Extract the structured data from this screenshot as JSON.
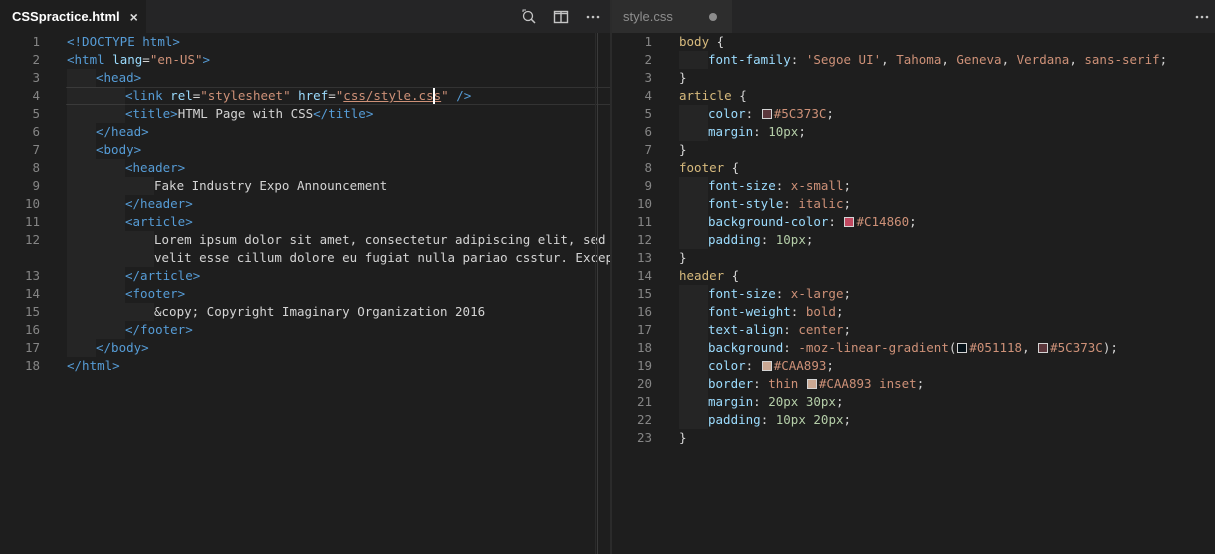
{
  "left_editor": {
    "tab": {
      "label": "CSSpractice.html",
      "close": "×"
    },
    "action_icons": [
      "open-changes-icon",
      "split-editor-icon",
      "more-actions-icon"
    ],
    "lines": [
      {
        "n": "1",
        "tokens": [
          [
            "tg",
            "<!DOCTYPE"
          ],
          [
            "br",
            " "
          ],
          [
            "tg",
            "html"
          ],
          [
            "tg",
            ">"
          ]
        ]
      },
      {
        "n": "2",
        "tokens": [
          [
            "tg",
            "<html"
          ],
          [
            "br",
            " "
          ],
          [
            "an",
            "lang"
          ],
          [
            "br",
            "="
          ],
          [
            "av",
            "\"en-US\""
          ],
          [
            "tg",
            ">"
          ]
        ]
      },
      {
        "n": "3",
        "indent": 1,
        "tokens": [
          [
            "tg",
            "<head>"
          ]
        ]
      },
      {
        "n": "4",
        "indent": 2,
        "tokens": [
          [
            "tg",
            "<link"
          ],
          [
            "br",
            " "
          ],
          [
            "an",
            "rel"
          ],
          [
            "br",
            "="
          ],
          [
            "av",
            "\"stylesheet\""
          ],
          [
            "br",
            " "
          ],
          [
            "an",
            "href"
          ],
          [
            "br",
            "="
          ],
          [
            "av",
            "\""
          ],
          [
            "avu",
            "css/style.css"
          ],
          [
            "av",
            "\""
          ],
          [
            "br",
            " "
          ],
          [
            "tg",
            "/>"
          ]
        ]
      },
      {
        "n": "5",
        "indent": 2,
        "tokens": [
          [
            "tg",
            "<title>"
          ],
          [
            "br",
            "HTML Page with CSS"
          ],
          [
            "tg",
            "</title>"
          ]
        ]
      },
      {
        "n": "6",
        "indent": 1,
        "tokens": [
          [
            "tg",
            "</head>"
          ]
        ]
      },
      {
        "n": "7",
        "indent": 1,
        "tokens": [
          [
            "tg",
            "<body>"
          ]
        ]
      },
      {
        "n": "8",
        "indent": 2,
        "tokens": [
          [
            "tg",
            "<header>"
          ]
        ]
      },
      {
        "n": "9",
        "indent": 3,
        "tokens": [
          [
            "br",
            "Fake Industry Expo Announcement"
          ]
        ]
      },
      {
        "n": "10",
        "indent": 2,
        "tokens": [
          [
            "tg",
            "</header>"
          ]
        ]
      },
      {
        "n": "11",
        "indent": 2,
        "tokens": [
          [
            "tg",
            "<article>"
          ]
        ]
      },
      {
        "n": "12",
        "indent": 3,
        "tokens": [
          [
            "br",
            "Lorem ipsum dolor sit amet, consectetur adipiscing elit, sed do"
          ]
        ]
      },
      {
        "n": "",
        "indent": 3,
        "tokens": [
          [
            "br",
            "velit esse cillum dolore eu fugiat nulla pariao csstur. Excepter"
          ]
        ]
      },
      {
        "n": "13",
        "indent": 2,
        "tokens": [
          [
            "tg",
            "</article>"
          ]
        ]
      },
      {
        "n": "14",
        "indent": 2,
        "tokens": [
          [
            "tg",
            "<footer>"
          ]
        ]
      },
      {
        "n": "15",
        "indent": 3,
        "tokens": [
          [
            "br",
            "&copy; Copyright Imaginary Organization 2016"
          ]
        ]
      },
      {
        "n": "16",
        "indent": 2,
        "tokens": [
          [
            "tg",
            "</footer>"
          ]
        ]
      },
      {
        "n": "17",
        "indent": 1,
        "tokens": [
          [
            "tg",
            "</body>"
          ]
        ]
      },
      {
        "n": "18",
        "tokens": [
          [
            "tg",
            "</html>"
          ]
        ]
      }
    ]
  },
  "right_editor": {
    "tab": {
      "label": "style.css",
      "dirty": true
    },
    "action_icons": [
      "more-actions-icon"
    ],
    "lines": [
      {
        "n": "1",
        "tokens": [
          [
            "sel",
            "body"
          ],
          [
            "br",
            " {"
          ]
        ]
      },
      {
        "n": "2",
        "indent": 1,
        "tokens": [
          [
            "pr",
            "font-family"
          ],
          [
            "br",
            ": "
          ],
          [
            "vl",
            "'Segoe UI'"
          ],
          [
            "br",
            ", "
          ],
          [
            "vl",
            "Tahoma"
          ],
          [
            "br",
            ", "
          ],
          [
            "vl",
            "Geneva"
          ],
          [
            "br",
            ", "
          ],
          [
            "vl",
            "Verdana"
          ],
          [
            "br",
            ", "
          ],
          [
            "vl",
            "sans-serif"
          ],
          [
            "br",
            ";"
          ]
        ]
      },
      {
        "n": "3",
        "tokens": [
          [
            "br",
            "}"
          ]
        ]
      },
      {
        "n": "4",
        "tokens": [
          [
            "sel",
            "article"
          ],
          [
            "br",
            " {"
          ]
        ]
      },
      {
        "n": "5",
        "indent": 1,
        "tokens": [
          [
            "pr",
            "color"
          ],
          [
            "br",
            ": "
          ],
          [
            "sw",
            "#5C373C"
          ],
          [
            "vl",
            "#5C373C"
          ],
          [
            "br",
            ";"
          ]
        ]
      },
      {
        "n": "6",
        "indent": 1,
        "tokens": [
          [
            "pr",
            "margin"
          ],
          [
            "br",
            ": "
          ],
          [
            "nm",
            "10px"
          ],
          [
            "br",
            ";"
          ]
        ]
      },
      {
        "n": "7",
        "tokens": [
          [
            "br",
            "}"
          ]
        ]
      },
      {
        "n": "8",
        "tokens": [
          [
            "sel",
            "footer"
          ],
          [
            "br",
            " {"
          ]
        ]
      },
      {
        "n": "9",
        "indent": 1,
        "tokens": [
          [
            "pr",
            "font-size"
          ],
          [
            "br",
            ": "
          ],
          [
            "vl",
            "x-small"
          ],
          [
            "br",
            ";"
          ]
        ]
      },
      {
        "n": "10",
        "indent": 1,
        "tokens": [
          [
            "pr",
            "font-style"
          ],
          [
            "br",
            ": "
          ],
          [
            "vl",
            "italic"
          ],
          [
            "br",
            ";"
          ]
        ]
      },
      {
        "n": "11",
        "indent": 1,
        "tokens": [
          [
            "pr",
            "background-color"
          ],
          [
            "br",
            ": "
          ],
          [
            "sw",
            "#C14860"
          ],
          [
            "vl",
            "#C14860"
          ],
          [
            "br",
            ";"
          ]
        ]
      },
      {
        "n": "12",
        "indent": 1,
        "tokens": [
          [
            "pr",
            "padding"
          ],
          [
            "br",
            ": "
          ],
          [
            "nm",
            "10px"
          ],
          [
            "br",
            ";"
          ]
        ]
      },
      {
        "n": "13",
        "tokens": [
          [
            "br",
            "}"
          ]
        ]
      },
      {
        "n": "14",
        "tokens": [
          [
            "sel",
            "header"
          ],
          [
            "br",
            " {"
          ]
        ]
      },
      {
        "n": "15",
        "indent": 1,
        "tokens": [
          [
            "pr",
            "font-size"
          ],
          [
            "br",
            ": "
          ],
          [
            "vl",
            "x-large"
          ],
          [
            "br",
            ";"
          ]
        ]
      },
      {
        "n": "16",
        "indent": 1,
        "tokens": [
          [
            "pr",
            "font-weight"
          ],
          [
            "br",
            ": "
          ],
          [
            "vl",
            "bold"
          ],
          [
            "br",
            ";"
          ]
        ]
      },
      {
        "n": "17",
        "indent": 1,
        "tokens": [
          [
            "pr",
            "text-align"
          ],
          [
            "br",
            ": "
          ],
          [
            "vl",
            "center"
          ],
          [
            "br",
            ";"
          ]
        ]
      },
      {
        "n": "18",
        "indent": 1,
        "tokens": [
          [
            "pr",
            "background"
          ],
          [
            "br",
            ": "
          ],
          [
            "vl",
            "-moz-linear-gradient"
          ],
          [
            "br",
            "("
          ],
          [
            "sw",
            "#051118"
          ],
          [
            "vl",
            "#051118"
          ],
          [
            "br",
            ", "
          ],
          [
            "sw",
            "#5C373C"
          ],
          [
            "vl",
            "#5C373C"
          ],
          [
            "br",
            ");"
          ]
        ]
      },
      {
        "n": "19",
        "indent": 1,
        "tokens": [
          [
            "pr",
            "color"
          ],
          [
            "br",
            ": "
          ],
          [
            "sw",
            "#CAA893"
          ],
          [
            "vl",
            "#CAA893"
          ],
          [
            "br",
            ";"
          ]
        ]
      },
      {
        "n": "20",
        "indent": 1,
        "tokens": [
          [
            "pr",
            "border"
          ],
          [
            "br",
            ": "
          ],
          [
            "vl",
            "thin"
          ],
          [
            "br",
            " "
          ],
          [
            "sw",
            "#CAA893"
          ],
          [
            "vl",
            "#CAA893"
          ],
          [
            "br",
            " "
          ],
          [
            "vl",
            "inset"
          ],
          [
            "br",
            ";"
          ]
        ]
      },
      {
        "n": "21",
        "indent": 1,
        "tokens": [
          [
            "pr",
            "margin"
          ],
          [
            "br",
            ": "
          ],
          [
            "nm",
            "20px"
          ],
          [
            "br",
            " "
          ],
          [
            "nm",
            "30px"
          ],
          [
            "br",
            ";"
          ]
        ]
      },
      {
        "n": "22",
        "indent": 1,
        "tokens": [
          [
            "pr",
            "padding"
          ],
          [
            "br",
            ": "
          ],
          [
            "nm",
            "10px"
          ],
          [
            "br",
            " "
          ],
          [
            "nm",
            "20px"
          ],
          [
            "br",
            ";"
          ]
        ]
      },
      {
        "n": "23",
        "tokens": [
          [
            "br",
            "}"
          ]
        ]
      }
    ]
  },
  "colors": {
    "background": "#1e1e1e",
    "tabbar": "#252526",
    "line_number": "#858585",
    "tag": "#569cd6",
    "attr": "#9cdcfe",
    "string": "#ce9178",
    "selector": "#d7ba7d",
    "number": "#b5cea8"
  }
}
